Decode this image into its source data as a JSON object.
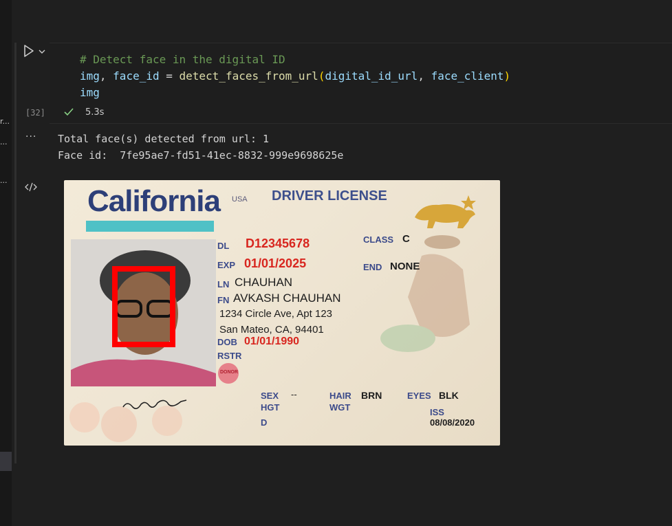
{
  "left_strip": {
    "items": [
      "r...",
      "...",
      "..."
    ]
  },
  "cell": {
    "execution_count": "[32]",
    "exec_time": "5.3s",
    "code": {
      "comment": "# Detect face in the digital ID",
      "line2_var1": "img",
      "line2_sep": ", ",
      "line2_var2": "face_id",
      "line2_eq": " = ",
      "line2_fn": "detect_faces_from_url",
      "line2_open": "(",
      "line2_arg1": "digital_id_url",
      "line2_argsep": ", ",
      "line2_arg2": "face_client",
      "line2_close": ")",
      "line3": "img"
    }
  },
  "output": {
    "more_label": "···",
    "line1": "Total face(s) detected from url: 1",
    "line2": "Face id:  7fe95ae7-fd51-41ec-8832-999e9698625e"
  },
  "id_card": {
    "state": "California",
    "usa": "USA",
    "type": "DRIVER LICENSE",
    "dl_label": "DL",
    "dl_value": "D12345678",
    "exp_label": "EXP",
    "exp_value": "01/01/2025",
    "ln_label": "LN",
    "ln_value": "CHAUHAN",
    "fn_label": "FN",
    "fn_value": "AVKASH CHAUHAN",
    "address1": "1234 Circle Ave, Apt 123",
    "address2": "San Mateo, CA, 94401",
    "dob_label": "DOB",
    "dob_value": "01/01/1990",
    "rstr_label": "RSTR",
    "class_label": "CLASS",
    "class_value": "C",
    "end_label": "END",
    "end_value": "NONE",
    "donor": "DONOR",
    "sex_label": "SEX",
    "sex_value": "--",
    "hgt_label": "HGT",
    "hair_label": "HAIR",
    "hair_value": "BRN",
    "wgt_label": "WGT",
    "eyes_label": "EYES",
    "eyes_value": "BLK",
    "iss_label": "ISS",
    "iss_value": "08/08/2020",
    "d_label": "D",
    "face_box_color": "#ff0000"
  }
}
